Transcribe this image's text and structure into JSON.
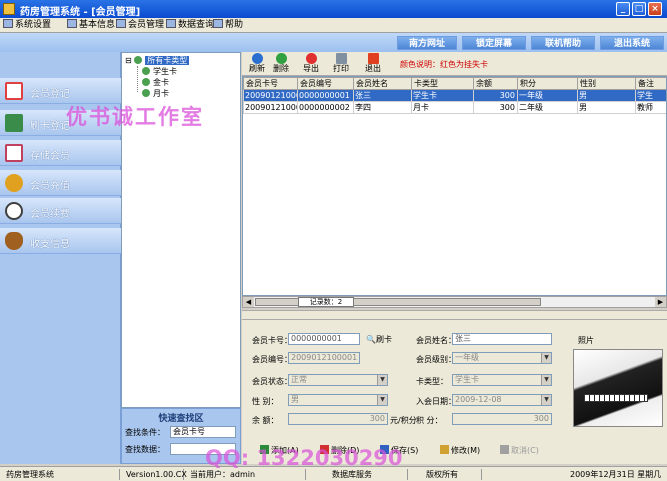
{
  "window": {
    "title": "药房管理系统 - [会员管理]",
    "buttons": {
      "minimize": "_",
      "maximize": "□",
      "close": "×"
    }
  },
  "menubar": {
    "items": [
      {
        "label": "系统设置",
        "icon": "settings-icon"
      },
      {
        "label": "基本信息",
        "icon": "info-icon"
      },
      {
        "label": "会员管理",
        "icon": "members-icon"
      },
      {
        "label": "数据查询",
        "icon": "query-icon"
      },
      {
        "label": "帮助",
        "icon": "help-icon"
      }
    ]
  },
  "header_tabs": [
    "南方网址",
    "锁定屏幕",
    "联机帮助",
    "退出系统"
  ],
  "leftnav": {
    "items": [
      {
        "label": "会员登记",
        "icon": "register-icon",
        "color": "#e04040"
      },
      {
        "label": "刷卡登记",
        "icon": "card-swipe-icon",
        "color": "#3a8c4a"
      },
      {
        "label": "存储会员",
        "icon": "storage-icon",
        "color": "#c04060"
      },
      {
        "label": "会员充值",
        "icon": "recharge-icon",
        "color": "#e0a020"
      },
      {
        "label": "会员续费",
        "icon": "renew-icon",
        "color": "#404040"
      },
      {
        "label": "收支信息",
        "icon": "money-bag-icon",
        "color": "#a06020"
      }
    ]
  },
  "tree": {
    "root": "所有卡类型",
    "children": [
      "学生卡",
      "金卡",
      "月卡"
    ]
  },
  "search": {
    "title": "快速查找区",
    "field_label": "查找条件：",
    "field_value": "会员卡号",
    "content_label": "查找数据："
  },
  "toolbar": {
    "buttons": [
      {
        "label": "刷新",
        "icon": "refresh-icon",
        "color": "#2a6fd0"
      },
      {
        "label": "删除",
        "icon": "delete-icon",
        "color": "#30a040"
      },
      {
        "label": "导出",
        "icon": "export-icon",
        "color": "#e03030"
      },
      {
        "label": "打印",
        "icon": "print-icon",
        "color": "#8090a0"
      },
      {
        "label": "退出",
        "icon": "exit-icon",
        "color": "#e04020"
      }
    ],
    "hint": "颜色说明：红色为挂失卡"
  },
  "grid": {
    "columns": [
      "会员卡号",
      "会员编号",
      "会员姓名",
      "卡类型",
      "余额",
      "积分",
      "性别",
      "备注"
    ],
    "rows": [
      {
        "card": "2009012100001",
        "id": "0000000001",
        "name": "张三",
        "type": "学生卡",
        "balance": "300",
        "points": "一年级",
        "gender": "男",
        "remark": "学生"
      },
      {
        "card": "2009012100002",
        "id": "0000000002",
        "name": "李四",
        "type": "月卡",
        "balance": "300",
        "points": "二年级",
        "gender": "男",
        "remark": "教师"
      }
    ],
    "record_tab": "记录数：2"
  },
  "form": {
    "card_no_label": "会员卡号：",
    "card_no_value": "0000000001",
    "swipe_button": "刷卡",
    "name_label": "会员姓名：",
    "name_value": "张三",
    "photo_label": "照片",
    "member_id_label": "会员编号：",
    "member_id_value": "2009012100001",
    "grade_label": "会员级别：",
    "grade_value": "一年级",
    "status_label": "会员状态：",
    "status_value": "正常",
    "card_type_label": "卡类型：",
    "card_type_value": "学生卡",
    "gender_label": "性    别：",
    "gender_value": "男",
    "join_date_label": "入会日期：",
    "join_date_value": "2009-12-08",
    "balance_label": "余    额：",
    "balance_value": "300",
    "unit_label": "元/积分",
    "points_label": "积    分：",
    "points_value": "300",
    "actions": [
      {
        "label": "添加(A)",
        "icon": "add-icon",
        "color": "#2a8c3a"
      },
      {
        "label": "删除(D)",
        "icon": "delete-icon",
        "color": "#d03030"
      },
      {
        "label": "保存(S)",
        "icon": "save-icon",
        "color": "#3060c0"
      },
      {
        "label": "修改(M)",
        "icon": "edit-icon",
        "color": "#d0a030"
      },
      {
        "label": "取消(C)",
        "icon": "cancel-icon",
        "color": "#a0a0a0"
      }
    ]
  },
  "statusbar": {
    "items": [
      "药房管理系统",
      "Version1.00.CX",
      "当前用户：admin",
      "数据库服务",
      "版权所有",
      "2009年12月31日 星期几"
    ]
  },
  "watermarks": {
    "studio": "优书诚工作室",
    "qq": "QQ: 1322030290"
  }
}
